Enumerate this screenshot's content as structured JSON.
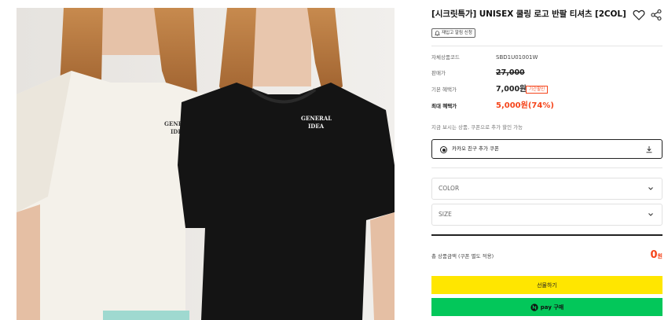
{
  "product": {
    "title": "[시크릿특가] UNISEX 쿨링 로고 반팔 티셔츠 [2COL]",
    "restock_label": "재입고 알림 신청",
    "image_logo_text": "GENERAL IDEA"
  },
  "info": {
    "code_label": "자체상품코드",
    "code_value": "SBD1U01001W",
    "price_label": "판매가",
    "price_value": "27,000",
    "benefit_label": "기본 혜택가",
    "benefit_value": "7,000원",
    "benefit_badge": "기간할인",
    "max_label": "최대 혜택가",
    "max_value": "5,000원(74%)",
    "note": "지금 보시는 상품, 쿠폰으로 추가 할인 가능"
  },
  "coupon": {
    "label": "카카오 친구 추가 쿠폰"
  },
  "options": {
    "color_placeholder": "COLOR",
    "size_placeholder": "SIZE"
  },
  "total": {
    "label": "총 상품금액 (쿠폰 별도 적용)",
    "amount": "0",
    "unit": "원"
  },
  "buttons": {
    "buy": "선물하기",
    "npay": "pay 구매"
  },
  "colors": {
    "accent_red": "#f5441a",
    "buy_yellow": "#ffe600",
    "npay_green": "#03c75a"
  }
}
